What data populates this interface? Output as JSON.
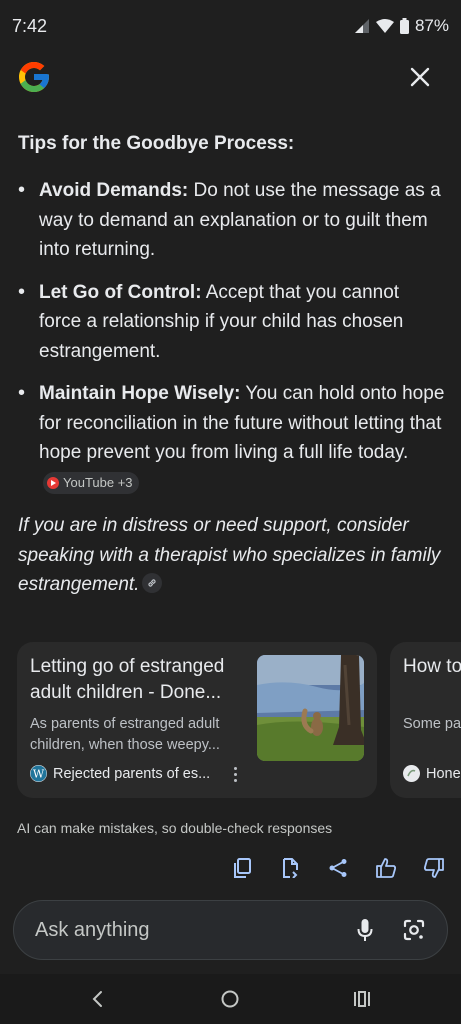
{
  "status_bar": {
    "time": "7:42",
    "battery": "87%"
  },
  "header": {
    "logo_icon": "google-g-icon",
    "close_icon": "close-icon"
  },
  "content": {
    "title": "Tips for the Goodbye Process:",
    "tips": [
      {
        "label": "Avoid Demands:",
        "text": " Do not use the message as a way to demand an explanation or to guilt them into returning."
      },
      {
        "label": "Let Go of Control:",
        "text": " Accept that you cannot force a relationship if your child has chosen estrangement."
      },
      {
        "label": "Maintain Hope Wisely:",
        "text": " You can hold onto hope for reconciliation in the future without letting that hope prevent you from living a full life today.",
        "source_chip": "YouTube +3"
      }
    ],
    "note": "If you are in distress or need support, consider speaking with a therapist who specializes in family estrangement."
  },
  "cards": [
    {
      "title": "Letting go of estranged adult children - Done...",
      "snippet": "As parents of estranged adult children, when those weepy...",
      "source": "Rejected parents of es...",
      "source_icon": "wordpress-icon",
      "thumbnail": "squirrel-under-tree-image"
    },
    {
      "title": "How to Write an Estr...",
      "snippet": "Some pa... or messa...",
      "source": "Hone",
      "source_icon": "site-logo-icon"
    }
  ],
  "disclaimer": "AI can make mistakes, so double-check responses",
  "actions": [
    "copy-icon",
    "export-doc-icon",
    "share-icon",
    "thumbs-up-icon",
    "thumbs-down-icon"
  ],
  "ask_bar": {
    "placeholder": "Ask anything"
  },
  "colors": {
    "background": "#1f1f1f",
    "card": "#2a2a2a",
    "text": "#e8eaed",
    "muted": "#bdc1c6"
  }
}
